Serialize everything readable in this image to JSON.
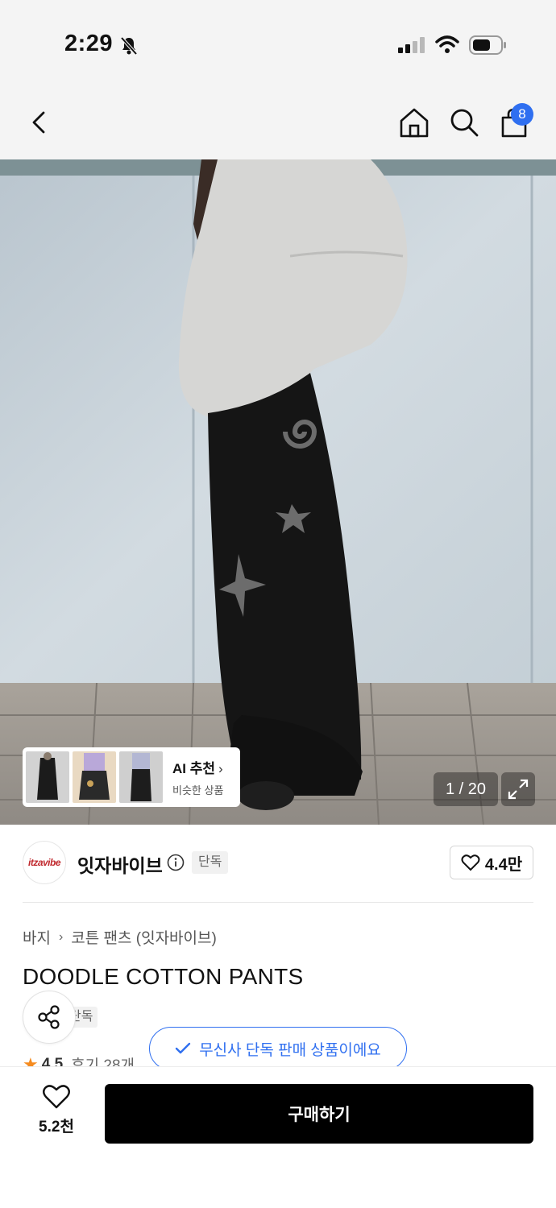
{
  "status_bar": {
    "time": "2:29"
  },
  "nav": {
    "cart_badge": "8"
  },
  "gallery": {
    "counter": "1 / 20",
    "ai_card": {
      "title": "AI 추천",
      "subtitle": "비슷한 상품"
    }
  },
  "brand": {
    "logo_text": "itzavibe",
    "name": "잇자바이브",
    "badge": "단독",
    "likes": "4.4만"
  },
  "product": {
    "breadcrumb": [
      "바지",
      "코튼 팬츠 (잇자바이브)"
    ],
    "title": "DOODLE COTTON PANTS",
    "tag": "단독",
    "rating": "4.5",
    "reviews": "후기 28개"
  },
  "toast": {
    "text": "무신사 단독 판매 상품이에요"
  },
  "bottom": {
    "wish_count": "5.2천",
    "buy_label": "구매하기"
  },
  "colors": {
    "accent": "#2f6ff0",
    "star": "#f58b1f",
    "buy_bg": "#000000"
  }
}
